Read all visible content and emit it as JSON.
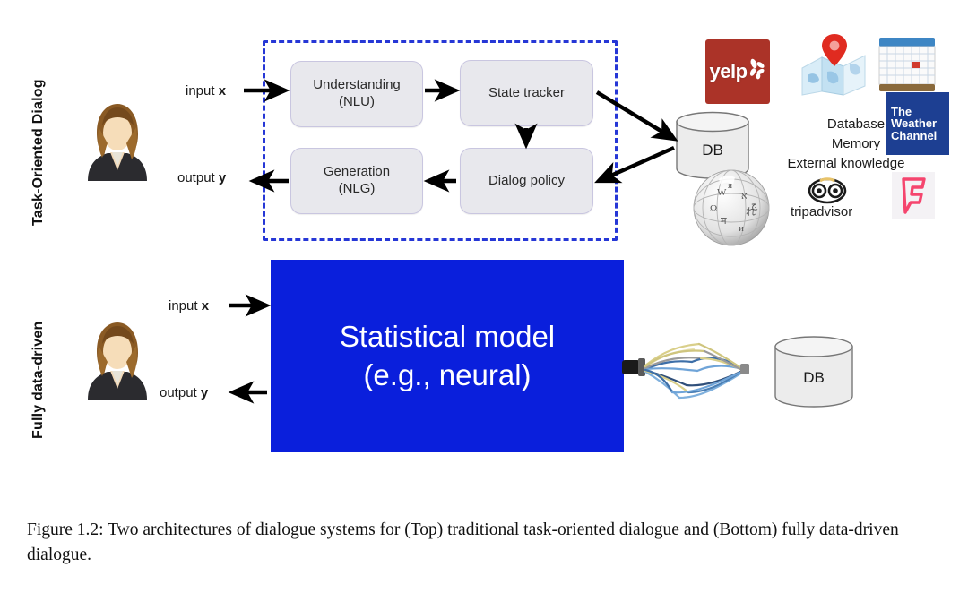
{
  "figure": {
    "caption": "Figure 1.2: Two architectures of dialogue systems for (Top) traditional task-oriented dialogue and (Bottom) fully data-driven dialogue."
  },
  "top_panel": {
    "side_label": "Task-Oriented Dialog",
    "avatar_name": "user-avatar",
    "input_label_text": "input ",
    "input_label_var": "x",
    "output_label_text": "output ",
    "output_label_var": "y",
    "boxes": [
      {
        "id": "nlu",
        "line1": "Understanding",
        "line2": "(NLU)"
      },
      {
        "id": "state-tracker",
        "line1": "State tracker",
        "line2": ""
      },
      {
        "id": "nlg",
        "line1": "Generation",
        "line2": "(NLG)"
      },
      {
        "id": "dialog-policy",
        "line1": "Dialog policy",
        "line2": ""
      }
    ],
    "db_label": "DB",
    "knowledge_lines": [
      "Database",
      "Memory",
      "External knowledge"
    ],
    "logos": [
      {
        "id": "yelp",
        "label": "yelp"
      },
      {
        "id": "map",
        "label": "map"
      },
      {
        "id": "calendar",
        "label": "calendar"
      },
      {
        "id": "weather-channel",
        "lines": [
          "The",
          "Weather",
          "Channel"
        ]
      },
      {
        "id": "wikipedia",
        "label": "Wikipedia"
      },
      {
        "id": "tripadvisor",
        "label": "tripadvisor"
      },
      {
        "id": "foursquare",
        "label": "Foursquare"
      }
    ]
  },
  "bottom_panel": {
    "side_label": "Fully data-driven",
    "avatar_name": "user-avatar",
    "input_label_text": "input ",
    "input_label_var": "x",
    "output_label_text": "output ",
    "output_label_var": "y",
    "model_line1": "Statistical model",
    "model_line2": "(e.g., neural)",
    "db_label": "DB"
  },
  "colors": {
    "dashed_border": "#2637d6",
    "model_box": "#0a1fdc",
    "pipeline_box_fill": "#e8e8ed",
    "pipeline_box_border": "#c9c6e0",
    "yelp_red": "#ab3328",
    "weather_blue": "#1d3f92",
    "foursquare_pink": "#f94877",
    "background": "#ffffff"
  }
}
